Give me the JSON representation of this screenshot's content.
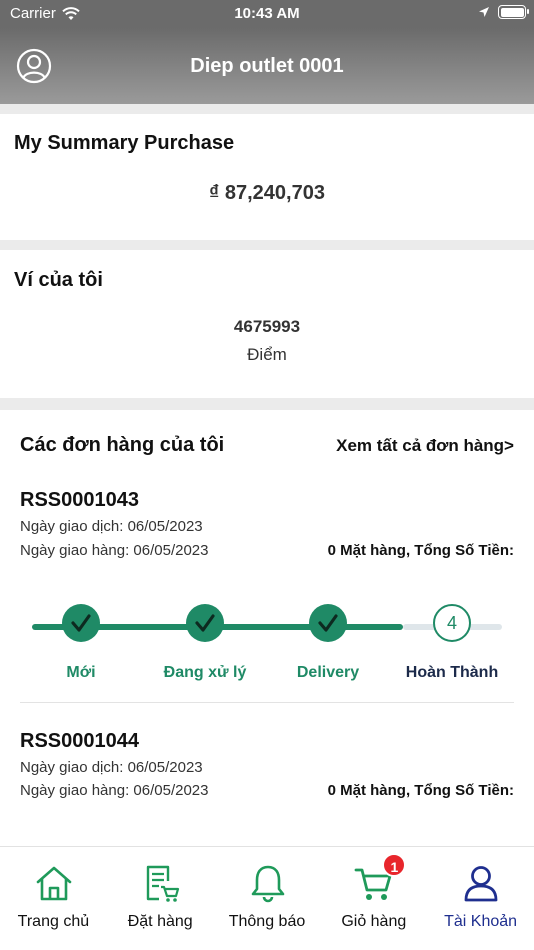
{
  "status_bar": {
    "carrier": "Carrier",
    "time": "10:43 AM"
  },
  "header": {
    "title": "Diep outlet 0001"
  },
  "summary": {
    "title": "My Summary Purchase",
    "amount": "₫ 87,240,703"
  },
  "wallet": {
    "title": "Ví của tôi",
    "points": "4675993",
    "points_unit": "Điểm"
  },
  "orders": {
    "title": "Các đơn hàng của tôi",
    "view_all": "Xem tất cả đơn hàng>",
    "items": [
      {
        "id": "RSS0001043",
        "transaction_date": "Ngày giao dịch: 06/05/2023",
        "delivery_date": "Ngày giao hàng: 06/05/2023",
        "summary": "0 Mặt hàng, Tổng Số Tiền:",
        "steps": [
          {
            "label": "Mới",
            "state": "done"
          },
          {
            "label": "Đang xử lý",
            "state": "done"
          },
          {
            "label": "Delivery",
            "state": "done"
          },
          {
            "label": "Hoàn Thành",
            "state": "pending",
            "number": "4"
          }
        ]
      },
      {
        "id": "RSS0001044",
        "transaction_date": "Ngày giao dịch: 06/05/2023",
        "delivery_date": "Ngày giao hàng: 06/05/2023",
        "summary": "0 Mặt hàng, Tổng Số Tiền:"
      }
    ]
  },
  "tabbar": {
    "items": [
      {
        "label": "Trang chủ",
        "icon": "home-icon"
      },
      {
        "label": "Đặt hàng",
        "icon": "order-icon"
      },
      {
        "label": "Thông báo",
        "icon": "bell-icon"
      },
      {
        "label": "Giỏ hàng",
        "icon": "cart-icon",
        "badge": "1"
      },
      {
        "label": "Tài Khoản",
        "icon": "user-icon",
        "active": true
      }
    ]
  },
  "colors": {
    "accent": "#1f8a66",
    "active_tab": "#1f2f8f",
    "badge": "#e8262c",
    "header": "#6b6b6b"
  }
}
